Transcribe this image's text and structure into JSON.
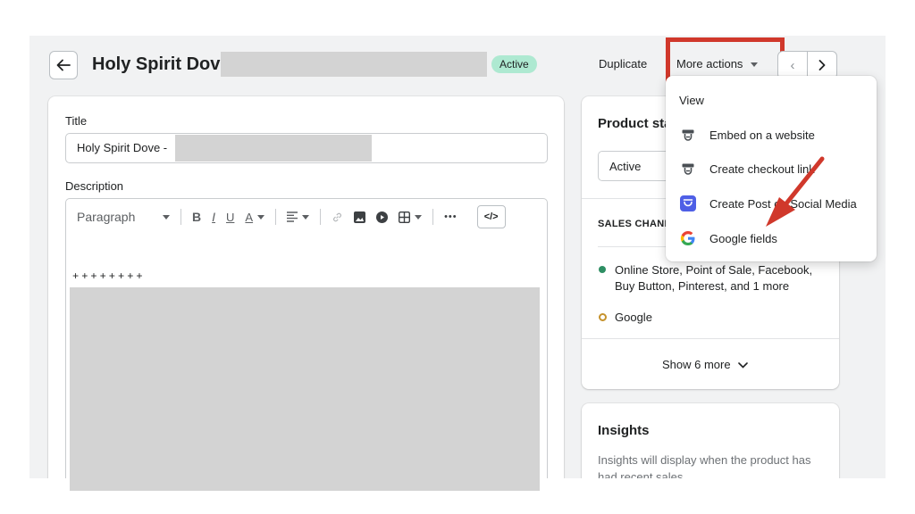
{
  "header": {
    "title": "Holy Spirit Dove",
    "status_badge": "Active",
    "duplicate_label": "Duplicate",
    "more_actions_label": "More actions"
  },
  "product_form": {
    "title_label": "Title",
    "title_value": "Holy Spirit Dove -",
    "description_label": "Description",
    "toolbar": {
      "paragraph_select": "Paragraph",
      "bold": "B",
      "italic": "I",
      "underline": "U",
      "text_color": "A",
      "more": "•••",
      "html_toggle": "</>"
    },
    "editor_text": "++++++++"
  },
  "status_card": {
    "title": "Product status",
    "status_value": "Active"
  },
  "sales_channels": {
    "heading": "SALES CHANNELS AND APPS",
    "channels": [
      {
        "name": "Online Store, Point of Sale, Facebook, Buy Button, Pinterest, and 1 more",
        "status_color": "#2e8e63"
      },
      {
        "name": "Google",
        "status_color": "#c5922c"
      }
    ],
    "show_more_label": "Show 6 more"
  },
  "insights": {
    "title": "Insights",
    "body": "Insights will display when the product has had recent sales"
  },
  "more_actions_menu": {
    "items": [
      {
        "label": "View",
        "icon": ""
      },
      {
        "label": "Embed on a website",
        "icon": "buy-button-icon"
      },
      {
        "label": "Create checkout link",
        "icon": "buy-button-icon"
      },
      {
        "label": "Create Post on Social Media",
        "icon": "social-post-app-icon"
      },
      {
        "label": "Google fields",
        "icon": "google-icon"
      }
    ]
  },
  "colors": {
    "highlight": "#d0382b",
    "arrow": "#d0382b",
    "active_badge": "#aee9d1",
    "redaction": "#d3d3d3"
  }
}
